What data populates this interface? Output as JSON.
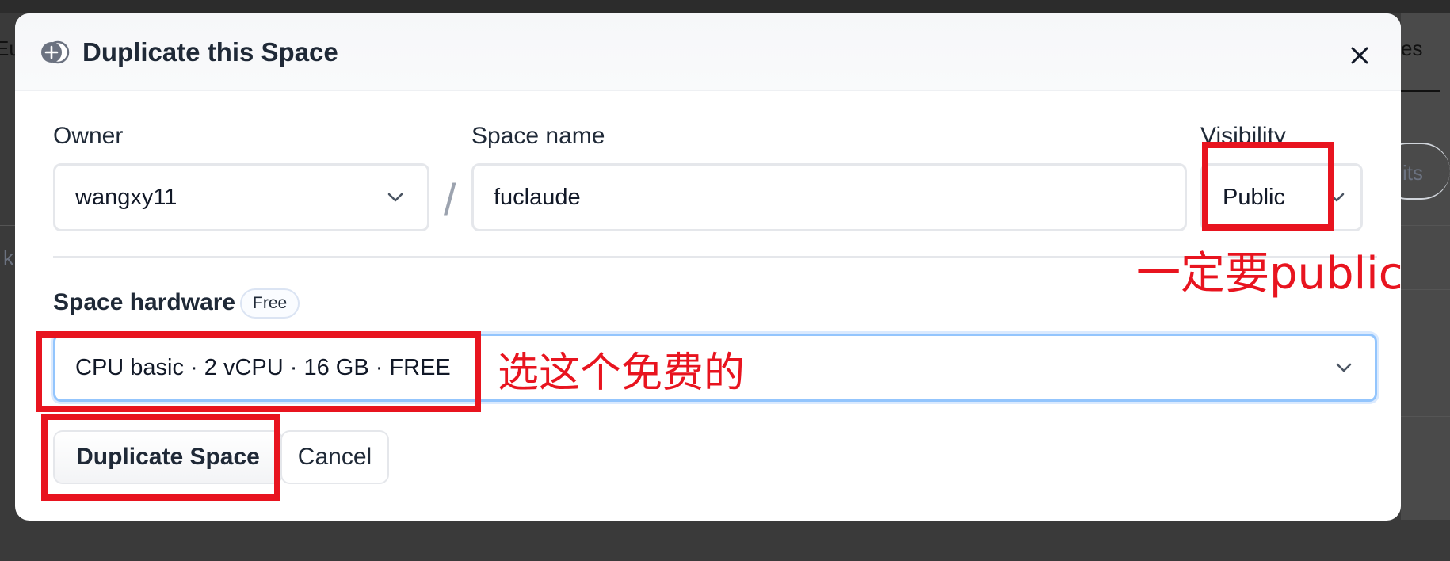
{
  "background": {
    "fragments": [
      "Eu",
      "es",
      "its",
      "k"
    ]
  },
  "modal": {
    "title": "Duplicate this Space",
    "owner": {
      "label": "Owner",
      "value": "wangxy11"
    },
    "separator": "/",
    "space_name": {
      "label": "Space name",
      "value": "fuclaude"
    },
    "visibility": {
      "label": "Visibility",
      "value": "Public"
    },
    "hardware": {
      "label": "Space hardware",
      "badge": "Free",
      "value": "CPU basic · 2 vCPU · 16 GB · FREE"
    },
    "buttons": {
      "duplicate": "Duplicate Space",
      "cancel": "Cancel"
    }
  },
  "annotations": {
    "visibility_note": "一定要public",
    "hardware_note": "选这个免费的",
    "color": "#e8141f"
  }
}
